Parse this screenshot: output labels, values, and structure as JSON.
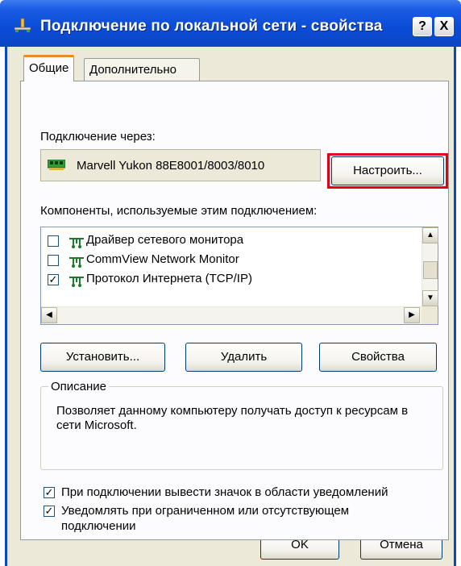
{
  "window": {
    "title": "Подключение по локальной сети - свойства",
    "help_label": "?",
    "close_label": "X"
  },
  "tabs": [
    {
      "label": "Общие",
      "active": true
    },
    {
      "label": "Дополнительно",
      "active": false
    }
  ],
  "connection": {
    "label": "Подключение через:",
    "device": "Marvell Yukon 88E8001/8003/8010",
    "configure_label": "Настроить..."
  },
  "components": {
    "label": "Компоненты, используемые этим подключением:",
    "items": [
      {
        "label": "Драйвер сетевого монитора",
        "checked": false
      },
      {
        "label": "CommView Network Monitor",
        "checked": false
      },
      {
        "label": "Протокол Интернета (TCP/IP)",
        "checked": true
      }
    ]
  },
  "actions": {
    "install": "Установить...",
    "remove": "Удалить",
    "properties": "Свойства"
  },
  "description": {
    "legend": "Описание",
    "text": "Позволяет данному компьютеру получать доступ к ресурсам в сети Microsoft."
  },
  "options": [
    {
      "label": "При подключении вывести значок в области уведомлений",
      "checked": true
    },
    {
      "label": "Уведомлять при ограниченном или отсутствующем подключении",
      "checked": true
    }
  ],
  "footer": {
    "ok": "OK",
    "cancel": "Отмена"
  },
  "colors": {
    "titlebar": "#0a4bd6",
    "face": "#ece9d8",
    "highlight": "#e0001a"
  }
}
